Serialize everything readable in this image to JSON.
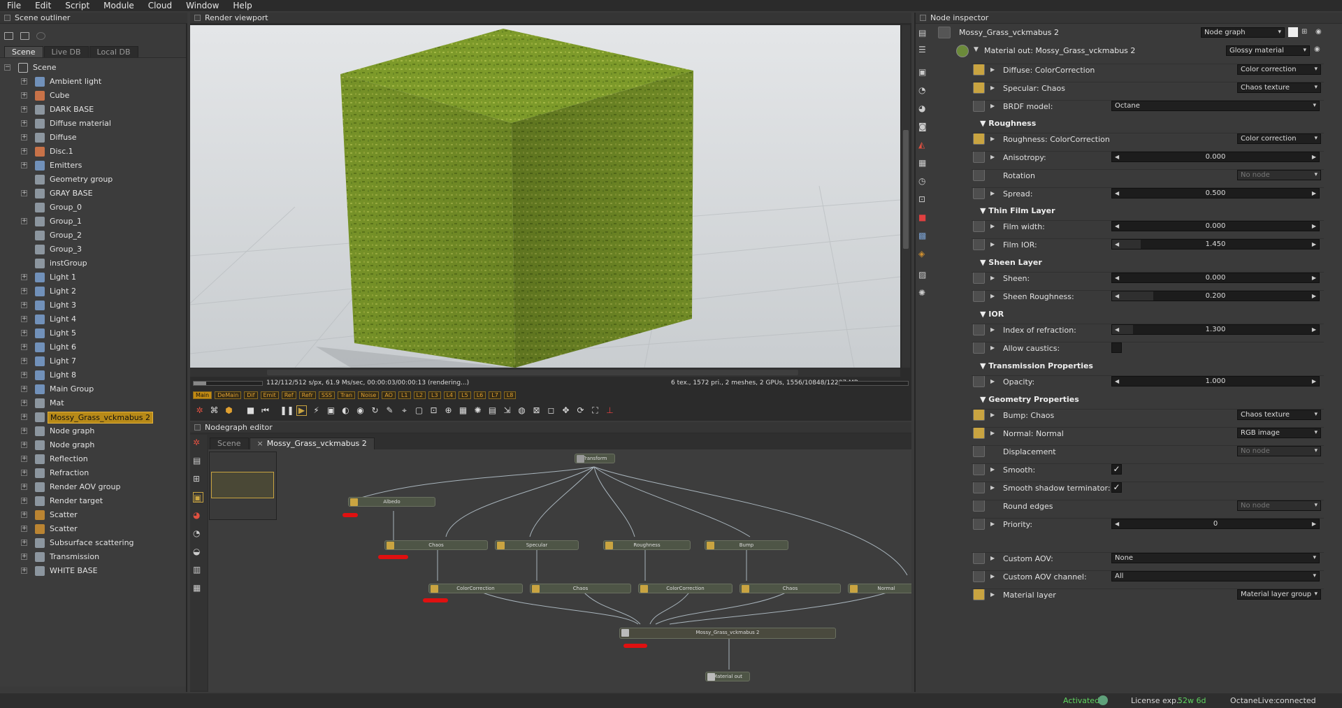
{
  "menu": [
    "File",
    "Edit",
    "Script",
    "Module",
    "Cloud",
    "Window",
    "Help"
  ],
  "outliner": {
    "title": "Scene outliner",
    "tabs": [
      "Scene",
      "Live DB",
      "Local DB"
    ],
    "root": "Scene",
    "items": [
      "Ambient light",
      "Cube",
      "DARK BASE",
      "Diffuse material",
      "Diffuse",
      "Disc.1",
      "Emitters",
      "Geometry group",
      "GRAY BASE",
      "Group_0",
      "Group_1",
      "Group_2",
      "Group_3",
      "instGroup",
      "Light 1",
      "Light 2",
      "Light 3",
      "Light 4",
      "Light 5",
      "Light 6",
      "Light 7",
      "Light 8",
      "Main Group",
      "Mat",
      "Mossy_Grass_vckmabus 2",
      "Node graph",
      "Node graph",
      "Reflection",
      "Refraction",
      "Render AOV group",
      "Render target",
      "Scatter",
      "Scatter",
      "Subsurface scattering",
      "Transmission",
      "WHITE BASE"
    ],
    "selected": "Mossy_Grass_vckmabus 2"
  },
  "viewport": {
    "title": "Render viewport",
    "status_left": "112/112/512 s/px, 61.9 Ms/sec, 00:00:03/00:00:13 (rendering...)",
    "status_right": "6 tex., 1572 pri., 2 meshes, 2 GPUs, 1556/10848/12287 MB",
    "passes": [
      "Main",
      "DeMain",
      "Dif",
      "Emit",
      "Ref",
      "Refr",
      "SSS",
      "Tran",
      "Noise",
      "AO",
      "L1",
      "L2",
      "L3",
      "L4",
      "L5",
      "L6",
      "L7",
      "L8"
    ],
    "active_pass": "Main"
  },
  "nodegraph": {
    "title": "Nodegraph editor",
    "tabs": [
      "Scene",
      "Mossy_Grass_vckmabus 2"
    ],
    "nodes": [
      "Transform",
      "Albedo",
      "Chaos",
      "Specular",
      "Roughness",
      "Bump",
      "ColorCorrection",
      "Chaos",
      "ColorCorrection",
      "Chaos",
      "Normal",
      "Mossy_Grass_vckmabus 2",
      "Material out"
    ]
  },
  "inspector": {
    "title": "Node inspector",
    "node_name": "Mossy_Grass_vckmabus 2",
    "view_mode": "Node graph",
    "material_out": "Material out: Mossy_Grass_vckmabus 2",
    "material_type": "Glossy material",
    "rows": {
      "diffuse": {
        "label": "Diffuse: ColorCorrection",
        "value": "Color correction"
      },
      "specular": {
        "label": "Specular: Chaos",
        "value": "Chaos texture"
      },
      "brdf": {
        "label": "BRDF model:",
        "value": "Octane"
      },
      "roughness_section": "Roughness",
      "roughness": {
        "label": "Roughness: ColorCorrection",
        "value": "Color correction"
      },
      "anisotropy": {
        "label": "Anisotropy:",
        "value": "0.000",
        "fraction": 0.0
      },
      "rotation": {
        "label": "Rotation",
        "value": "No node"
      },
      "spread": {
        "label": "Spread:",
        "value": "0.500",
        "fraction": 0.0
      },
      "thin_film_section": "Thin Film Layer",
      "film_width": {
        "label": "Film width:",
        "value": "0.000",
        "fraction": 0.0
      },
      "film_ior": {
        "label": "Film IOR:",
        "value": "1.450",
        "fraction": 0.14
      },
      "sheen_section": "Sheen Layer",
      "sheen": {
        "label": "Sheen:",
        "value": "0.000",
        "fraction": 0.0
      },
      "sheen_roughness": {
        "label": "Sheen Roughness:",
        "value": "0.200",
        "fraction": 0.2
      },
      "ior_section": "IOR",
      "ior": {
        "label": "Index of refraction:",
        "value": "1.300",
        "fraction": 0.1
      },
      "caustics": {
        "label": "Allow caustics:"
      },
      "transmission_section": "Transmission Properties",
      "opacity": {
        "label": "Opacity:",
        "value": "1.000",
        "fraction": 0.0
      },
      "geometry_section": "Geometry Properties",
      "bump": {
        "label": "Bump: Chaos",
        "value": "Chaos texture"
      },
      "normal": {
        "label": "Normal: Normal",
        "value": "RGB image"
      },
      "displacement": {
        "label": "Displacement",
        "value": "No node"
      },
      "smooth": {
        "label": "Smooth:",
        "check": "✓"
      },
      "smooth_shadow": {
        "label": "Smooth shadow terminator:",
        "check": "✓"
      },
      "round_edges": {
        "label": "Round edges",
        "value": "No node"
      },
      "priority": {
        "label": "Priority:",
        "value": "0"
      },
      "custom_aov": {
        "label": "Custom AOV:",
        "value": "None"
      },
      "custom_aov_channel": {
        "label": "Custom AOV channel:",
        "value": "All"
      },
      "material_layer": {
        "label": "Material layer",
        "value": "Material layer group"
      }
    }
  },
  "statusbar": {
    "activated": "Activated",
    "license_label": "License exp.:",
    "license_value": "52w 6d",
    "octanelive_label": "OctaneLive:",
    "octanelive_value": "connected"
  },
  "colors": {
    "accent": "#c9a441",
    "selected": "#b88a18",
    "active_green": "#5fd45f"
  }
}
